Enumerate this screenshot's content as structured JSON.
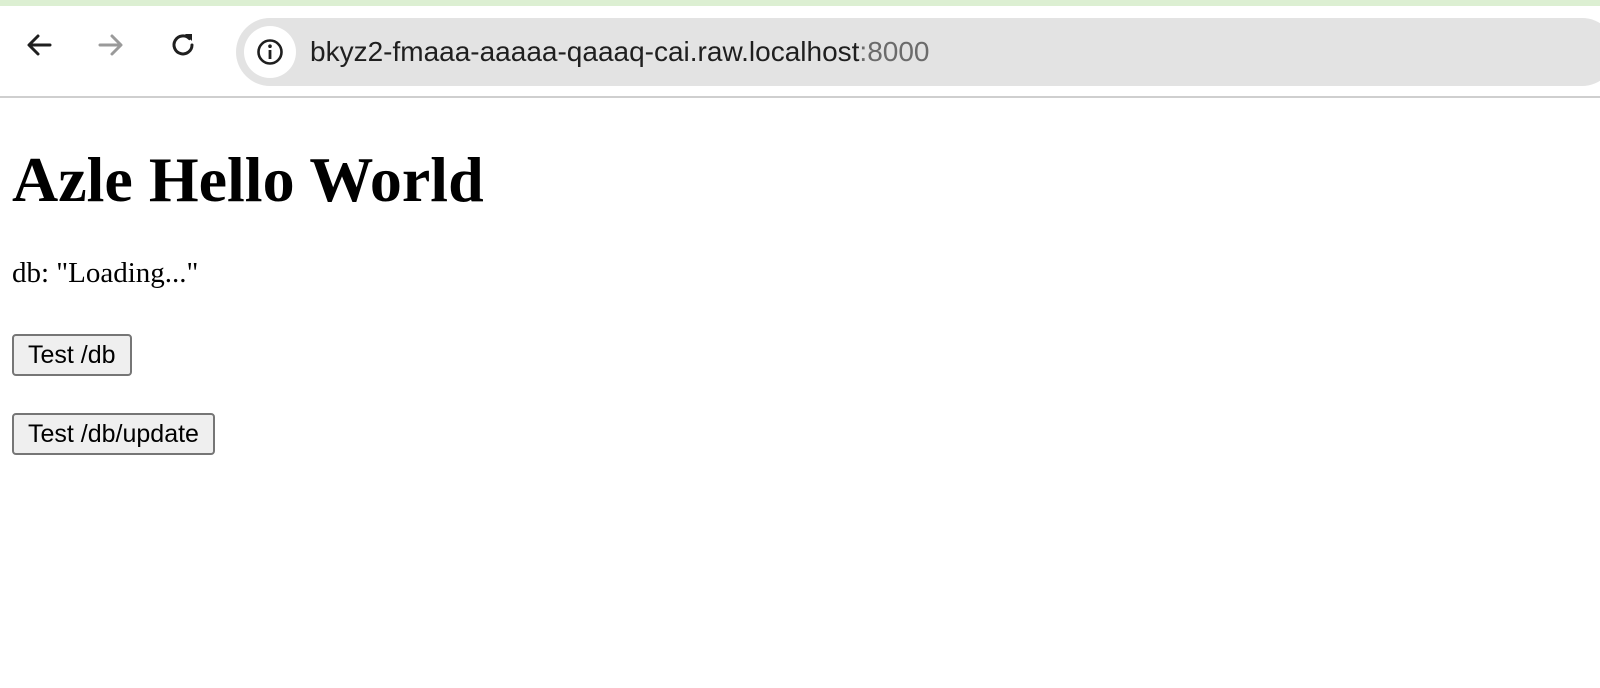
{
  "browser": {
    "url_host": "bkyz2-fmaaa-aaaaa-qaaaq-cai.raw.localhost",
    "url_port": ":8000",
    "icons": {
      "back": "arrow-left-icon",
      "forward": "arrow-right-icon",
      "reload": "reload-icon",
      "site_info": "info-icon"
    }
  },
  "page": {
    "heading": "Azle Hello World",
    "db_status": "db: \"Loading...\"",
    "buttons": {
      "test_db": "Test /db",
      "test_db_update": "Test /db/update"
    }
  }
}
